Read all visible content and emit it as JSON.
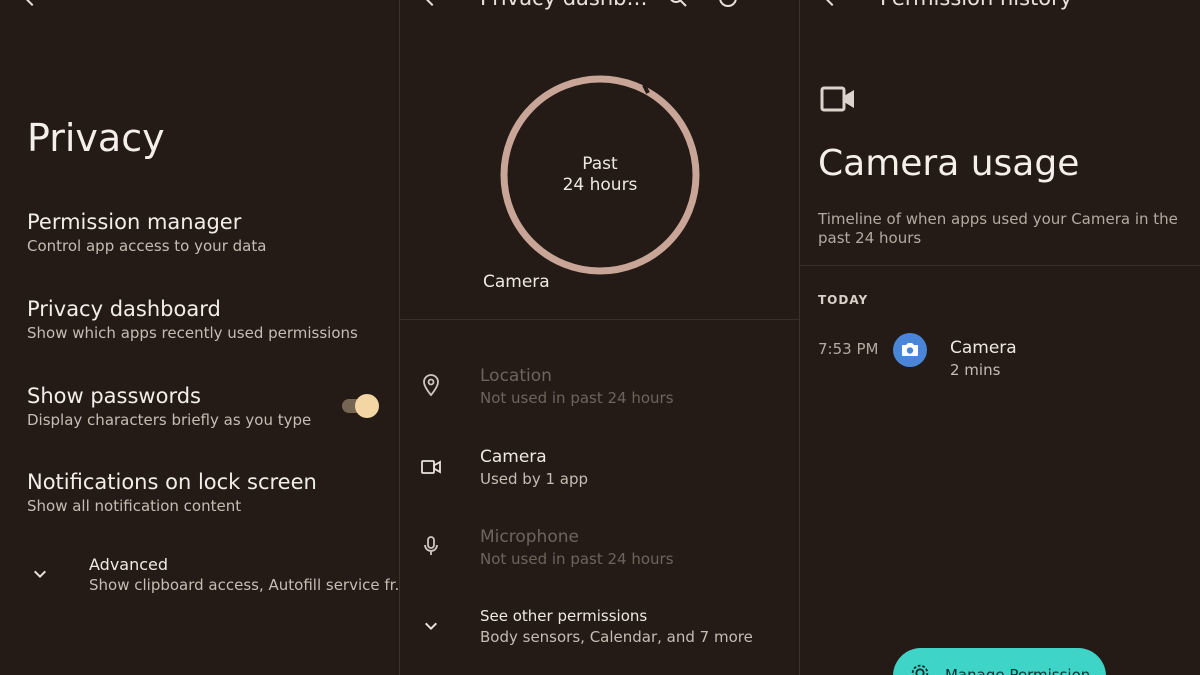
{
  "privacy": {
    "title": "Privacy",
    "items": [
      {
        "title": "Permission manager",
        "subtitle": "Control app access to your data"
      },
      {
        "title": "Privacy dashboard",
        "subtitle": "Show which apps recently used permissions"
      },
      {
        "title": "Show passwords",
        "subtitle": "Display characters briefly as you type",
        "toggle_on": true
      },
      {
        "title": "Notifications on lock screen",
        "subtitle": "Show all notification content"
      }
    ],
    "advanced": {
      "title": "Advanced",
      "subtitle": "Show clipboard access, Autofill service fr.."
    }
  },
  "dashboard": {
    "title": "Privacy dashb…",
    "ring": {
      "line1": "Past",
      "line2": "24 hours",
      "label": "Camera"
    },
    "permissions": [
      {
        "icon": "location-pin-icon",
        "title": "Location",
        "subtitle": "Not used in past 24 hours",
        "used": false
      },
      {
        "icon": "videocam-icon",
        "title": "Camera",
        "subtitle": "Used by 1 app",
        "used": true
      },
      {
        "icon": "microphone-icon",
        "title": "Microphone",
        "subtitle": "Not used in past 24 hours",
        "used": false
      }
    ],
    "other": {
      "title": "See other permissions",
      "subtitle": "Body sensors, Calendar, and 7 more"
    }
  },
  "history": {
    "title": "Permission history",
    "heading": "Camera usage",
    "description": "Timeline of when apps used your Camera in the past 24 hours",
    "section": "TODAY",
    "entries": [
      {
        "time": "7:53 PM",
        "app": "Camera",
        "duration": "2 mins",
        "icon": "camera-app-icon"
      }
    ],
    "fab_label": "Manage Permission"
  },
  "colors": {
    "background": "#241b16",
    "ring": "#c9a597",
    "toggle_thumb": "#f4d6a4",
    "fab": "#3fd4c8",
    "app_icon": "#4a86d8"
  }
}
